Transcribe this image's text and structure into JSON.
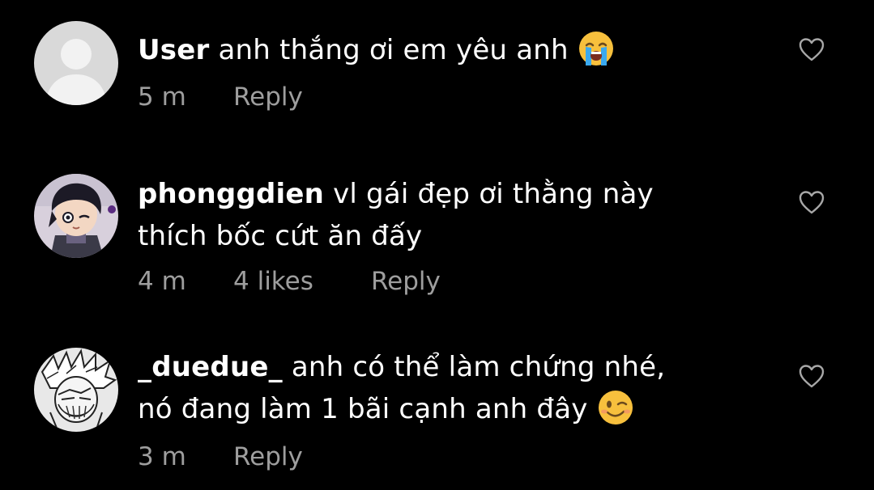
{
  "colors": {
    "background": "#000000",
    "text": "#ffffff",
    "meta_text": "#9e9e9e",
    "heart_outline": "#a8a8a8",
    "default_avatar_bg": "#d9d9d9"
  },
  "comments": [
    {
      "username": "User",
      "text": "anh thắng ơi em yêu anh",
      "emoji": "loudly-crying-face",
      "time": "5 m",
      "likes": "",
      "reply_label": "Reply",
      "avatar": "default-avatar"
    },
    {
      "username": "phonggdien",
      "text_line1": "vl gái đẹp ơi thằng này",
      "text_line2": "thích bốc cứt ăn đấy",
      "time": "4 m",
      "likes": "4 likes",
      "reply_label": "Reply",
      "avatar": "anime-boy-avatar"
    },
    {
      "username": "_duedue_",
      "text_line1": "anh có thể làm chứng nhé,",
      "text_line2": "nó đang làm 1 bãi cạnh anh đây",
      "emoji": "winking-face",
      "time": "3 m",
      "likes": "",
      "reply_label": "Reply",
      "avatar": "manga-sketch-avatar"
    }
  ]
}
